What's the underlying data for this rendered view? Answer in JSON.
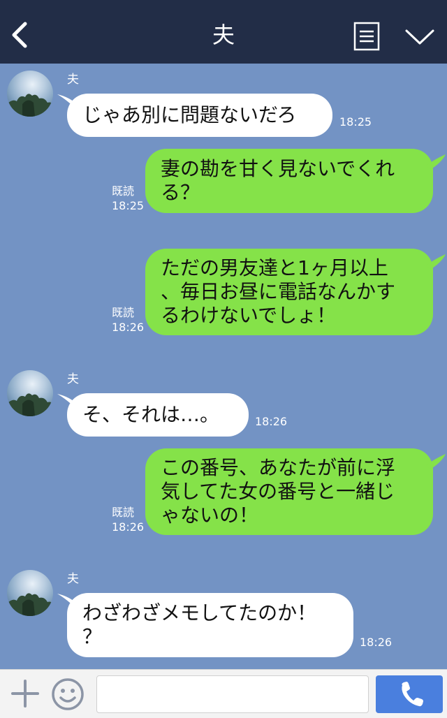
{
  "header": {
    "title": "夫",
    "back_icon": "chevron-left-icon",
    "menu_icon": "list-icon",
    "more_icon": "chevron-down-icon",
    "background": "#222d47"
  },
  "chat": {
    "background": "#7393c4",
    "incoming_bubble_color": "#ffffff",
    "outgoing_bubble_color": "#85e249",
    "messages": [
      {
        "direction": "in",
        "sender": "夫",
        "text": "じゃあ別に問題ないだろ",
        "time": "18:25"
      },
      {
        "direction": "out",
        "read": "既読",
        "text": "妻の勘を甘く見ないでくれ\nる？",
        "time": "18:25"
      },
      {
        "direction": "out",
        "read": "既読",
        "text": "ただの男友達と1ヶ月以上\n、毎日お昼に電話なんかす\nるわけないでしょ！",
        "time": "18:26"
      },
      {
        "direction": "in",
        "sender": "夫",
        "text": "そ、それは…。",
        "time": "18:26"
      },
      {
        "direction": "out",
        "read": "既読",
        "text": "この番号、あなたが前に浮\n気してた女の番号と一緒じ\nゃないの！",
        "time": "18:26"
      },
      {
        "direction": "in",
        "sender": "夫",
        "text": "わざわざメモしてたのか！\n？",
        "time": "18:26"
      }
    ]
  },
  "composer": {
    "plus_icon": "plus-icon",
    "emoji_icon": "smiley-icon",
    "input_value": "",
    "input_placeholder": "",
    "call_icon": "phone-icon",
    "call_color": "#4a7fde"
  }
}
